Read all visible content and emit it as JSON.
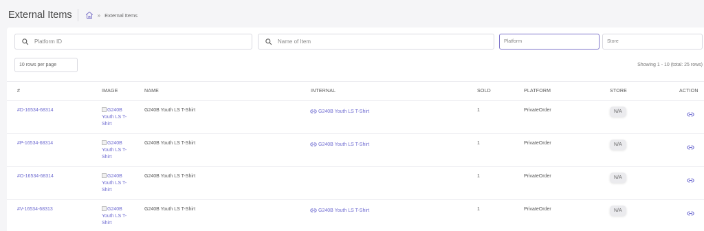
{
  "header": {
    "title": "External Items",
    "breadcrumb_home_icon": "home-icon",
    "breadcrumb_separator": "»",
    "breadcrumb_current": "External Items"
  },
  "filters": {
    "platform_id_placeholder": "Platform ID",
    "item_name_placeholder": "Name of Item",
    "platform_placeholder": "Platform",
    "store_placeholder": "Store"
  },
  "pagination": {
    "rows_per_page": "10 rows per page",
    "showing": "Showing 1 - 10 (total: 25 rows)"
  },
  "table": {
    "columns": [
      "#",
      "Image",
      "Name",
      "Internal",
      "Sold",
      "Platform",
      "Store",
      "Action"
    ],
    "rows": [
      {
        "id": "#D-16534-68314",
        "image_alt": "G240B Youth LS T-Shirt",
        "name": "G240B Youth LS T-Shirt",
        "internal": "G240B Youth LS T-Shirt",
        "sold": "1",
        "platform": "PrivateOrder",
        "store": "N/A"
      },
      {
        "id": "#P-16534-68314",
        "image_alt": "G240B Youth LS T-Shirt",
        "name": "G240B Youth LS T-Shirt",
        "internal": "G240B Youth LS T-Shirt",
        "sold": "1",
        "platform": "PrivateOrder",
        "store": "N/A"
      },
      {
        "id": "#O-16534-68314",
        "image_alt": "G240B Youth LS T-Shirt",
        "name": "G240B Youth LS T-Shirt",
        "internal": "",
        "sold": "1",
        "platform": "PrivateOrder",
        "store": "N/A"
      },
      {
        "id": "#V-16534-68313",
        "image_alt": "G240B Youth LS T-Shirt",
        "name": "G240B Youth LS T-Shirt",
        "internal": "G240B Youth LS T-Shirt",
        "sold": "1",
        "platform": "PrivateOrder",
        "store": "N/A"
      }
    ]
  },
  "colors": {
    "accent": "#6d6ad0",
    "active_border": "#7c73c9",
    "background": "#f5f5f7",
    "badge_bg": "#ebebee"
  },
  "icons": {
    "search": "search-icon",
    "link": "link-icon",
    "broken_image": "broken-image-icon"
  }
}
